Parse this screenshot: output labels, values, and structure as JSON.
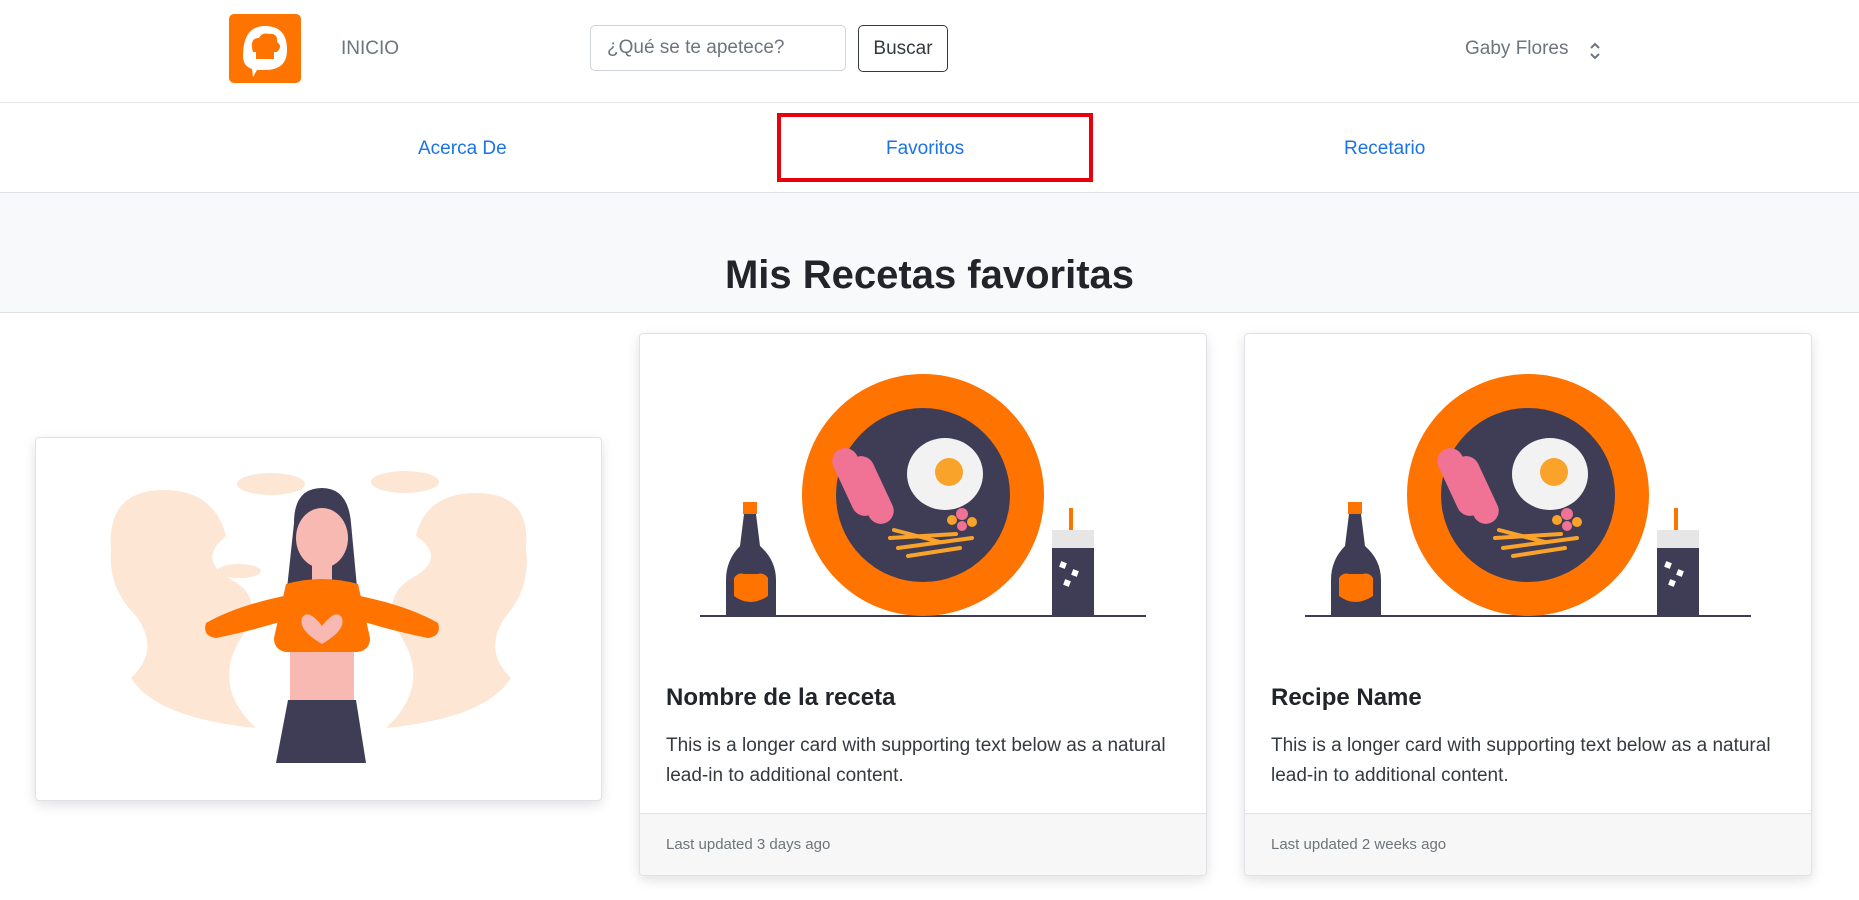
{
  "header": {
    "home_label": "INICIO",
    "search_placeholder": "¿Qué se te apetece?",
    "search_button": "Buscar",
    "user_name": "Gaby Flores"
  },
  "subnav": {
    "items": [
      "Acerca De",
      "Favoritos",
      "Recetario"
    ]
  },
  "page": {
    "title": "Mis Recetas favoritas"
  },
  "cards": [
    {
      "title": "Nombre de la receta",
      "text": "This is a longer card with supporting text below as a natural lead-in to additional content.",
      "footer": "Last updated 3 days ago"
    },
    {
      "title": "Recipe Name",
      "text": "This is a longer card with supporting text below as a natural lead-in to additional content.",
      "footer": "Last updated 2 weeks ago"
    }
  ],
  "colors": {
    "brand": "#ff7300",
    "link": "#1a73e8",
    "highlight": "#e8000b",
    "plate_dark": "#3f3d56"
  },
  "icons": [
    "chef-hat-chat-icon",
    "chevron-updown-icon"
  ]
}
